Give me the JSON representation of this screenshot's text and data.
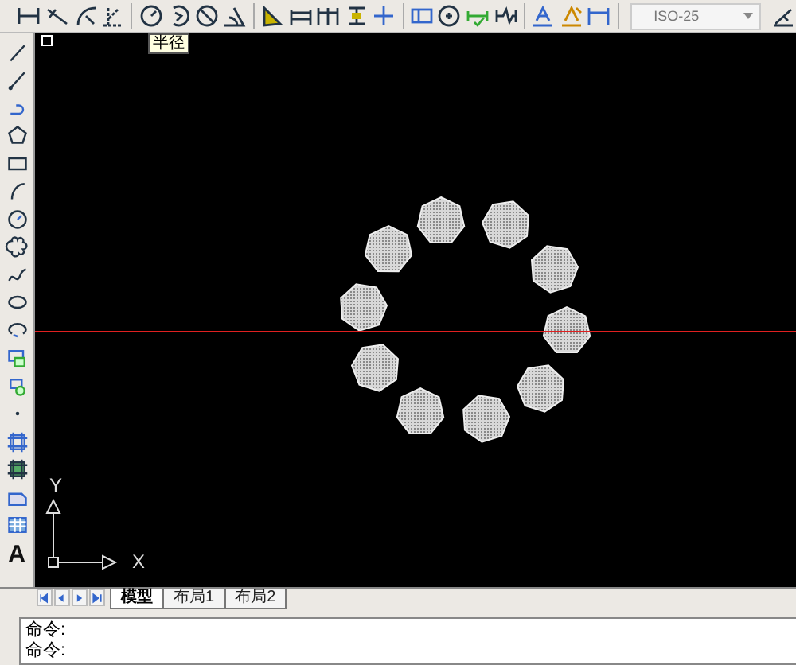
{
  "toolbar": {
    "dim_style": {
      "value": "ISO-25"
    }
  },
  "side_toolbar": {
    "text_tool": "A"
  },
  "canvas": {
    "tooltip": "半径",
    "axis_x": "X",
    "axis_y": "Y"
  },
  "layout_tabs": [
    {
      "label": "模型",
      "selected": true
    },
    {
      "label": "布局1",
      "selected": false
    },
    {
      "label": "布局2",
      "selected": false
    }
  ],
  "command_lines": [
    "命令:",
    "命令:"
  ]
}
